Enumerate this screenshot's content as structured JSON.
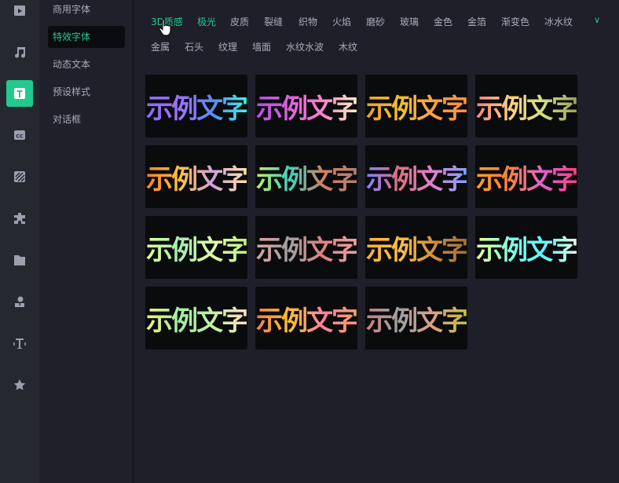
{
  "rail": {
    "items": [
      {
        "name": "media-icon"
      },
      {
        "name": "music-icon"
      },
      {
        "name": "text-icon",
        "active": true
      },
      {
        "name": "captions-icon"
      },
      {
        "name": "filter-icon"
      },
      {
        "name": "plugin-icon"
      },
      {
        "name": "folder-icon"
      },
      {
        "name": "person-icon"
      },
      {
        "name": "text-tool-icon"
      },
      {
        "name": "star-icon"
      }
    ]
  },
  "panel": {
    "items": [
      {
        "label": "商用字体"
      },
      {
        "label": "特效字体",
        "active": true
      },
      {
        "label": "动态文本"
      },
      {
        "label": "预设样式"
      },
      {
        "label": "对话框"
      }
    ]
  },
  "tabs": {
    "row1": [
      "3D质感",
      "极光",
      "皮质",
      "裂缝",
      "织物",
      "火焰",
      "磨砂",
      "玻璃",
      "金色",
      "金箔",
      "渐变色",
      "冰水纹"
    ],
    "row2": [
      "金属",
      "石头",
      "纹理",
      "墙面",
      "水纹水波",
      "木纹"
    ],
    "active": [
      "3D质感",
      "极光"
    ],
    "expand_icon": "chevron-down-icon"
  },
  "accent": "#22c98f",
  "sample_text": "示例文字",
  "tiles": [
    [
      "#8a6cf2",
      "#a070ff",
      "#5b8cf0",
      "#3ff0e8"
    ],
    [
      "#b050e0",
      "#e060e0",
      "#ff80c8",
      "#fff0c0"
    ],
    [
      "#f0a020",
      "#f0c030",
      "#ffa040",
      "#ff9040"
    ],
    [
      "#ff8080",
      "#ffd080",
      "#d0e080",
      "#a0a060"
    ],
    [
      "#ff8020",
      "#ffc040",
      "#d0a0e0",
      "#ffe0a0"
    ],
    [
      "#c0f060",
      "#40d0c0",
      "#d08060",
      "#b08070"
    ],
    [
      "#8080ff",
      "#e07080",
      "#e080d0",
      "#80a0ff"
    ],
    [
      "#ffa020",
      "#ff8040",
      "#e060d0",
      "#ff4080"
    ],
    [
      "#e0ff90",
      "#a0f0b0",
      "#e0ffa0",
      "#c0f080"
    ],
    [
      "#e0a0a0",
      "#a0a0a0",
      "#e08080",
      "#f0a0a0"
    ],
    [
      "#ffb030",
      "#ffc040",
      "#d09040",
      "#a07030"
    ],
    [
      "#f0ff90",
      "#80ffe0",
      "#60f0ff",
      "#e0ffe0"
    ],
    [
      "#f0f080",
      "#a0f0a0",
      "#c0f0a0",
      "#ffe0c0"
    ],
    [
      "#ff8040",
      "#ffc030",
      "#ff80a0",
      "#ffa060"
    ],
    [
      "#d08080",
      "#a0a0a0",
      "#e0a080",
      "#c0c040"
    ]
  ]
}
